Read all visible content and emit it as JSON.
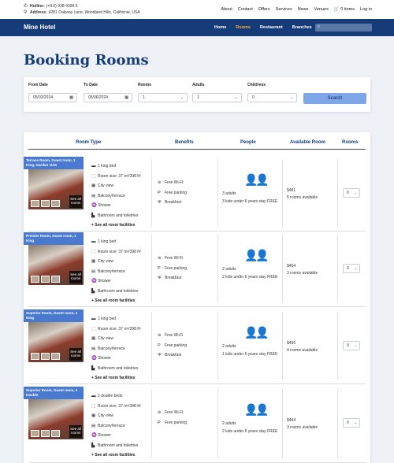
{
  "topbar": {
    "hotline_label": "Hotline:",
    "hotline_value": "(+8.0) 938-9399.5",
    "address_label": "Address:",
    "address_value": "4281 Oakway Lane, Woodland Hills, California, USA",
    "menu": [
      "About",
      "Contact",
      "Offers",
      "Services",
      "News",
      "Venues"
    ],
    "cart": "0 items",
    "login": "Log in"
  },
  "navbar": {
    "brand": "Mine Hotel",
    "links": [
      "Home",
      "Rooms",
      "Restaurant",
      "Branches"
    ],
    "active": "Rooms"
  },
  "page_title": "Booking Rooms",
  "form": {
    "from_label": "From Date",
    "from_value": "05/03/2024",
    "to_label": "To Date",
    "to_value": "05/06/2024",
    "rooms_label": "Rooms",
    "rooms_value": "1",
    "adults_label": "Adults",
    "adults_value": "1",
    "children_label": "Childrens",
    "children_value": "0",
    "search_label": "Search"
  },
  "table": {
    "headers": [
      "Room Type",
      "Benefits",
      "People",
      "Available Room",
      "Rooms"
    ],
    "see_all_photos": "See all rooms",
    "see_all_facilities": "+ See all room facilities",
    "rooms": [
      {
        "name": "Terrace Room, Guest room, 1 King, Garden view",
        "features": [
          "1 king bed",
          "Room size: 37 m²/398 ft²",
          "City view",
          "Balcony/terrace",
          "Shower",
          "Bathroom and toiletries"
        ],
        "benefits": [
          "Free Wi-Fi",
          "Free parking",
          "Breakfast"
        ],
        "adults": "3 adults",
        "kids": "3 kids under 6 years stay FREE",
        "price": "$481",
        "available": "5 rooms available",
        "qty": "0"
      },
      {
        "name": "Premier Room, Guest room, 1 King",
        "features": [
          "1 king bed",
          "Room size: 37 m²/398 ft²",
          "City view",
          "Balcony/terrace",
          "Shower",
          "Bathroom and toiletries"
        ],
        "benefits": [
          "Free Wi-Fi",
          "Free parking",
          "Breakfast"
        ],
        "adults": "2 adults",
        "kids": "2 kids under 6 years stay FREE",
        "price": "$454",
        "available": "3 rooms available",
        "qty": "0"
      },
      {
        "name": "Superior Room, Guest room, 1 King",
        "features": [
          "1 king bed",
          "Room size: 37 m²/398 ft²",
          "City view",
          "Balcony/terrace",
          "Shower",
          "Bathroom and toiletries"
        ],
        "benefits": [
          "Free Wi-Fi",
          "Free parking",
          "Breakfast"
        ],
        "adults": "2 adults",
        "kids": "1 kids under 6 years stay FREE",
        "price": "$496",
        "available": "4 rooms available",
        "qty": "0"
      },
      {
        "name": "Superior Room, Guest room, 2 Double",
        "features": [
          "2 double beds",
          "Room size: 37 m²/398 ft²",
          "City view",
          "Balcony/terrace",
          "Shower",
          "Bathroom and toiletries"
        ],
        "benefits": [
          "Free Wi-Fi",
          "Free parking"
        ],
        "adults": "2 adults",
        "kids": "2 kids under 6 years stay FREE",
        "price": "$444",
        "available": "3 rooms available",
        "qty": "0"
      }
    ]
  },
  "colors": {
    "navy": "#153c78",
    "accent": "#f3b23a",
    "button": "#7fa6e8",
    "label": "#4a7ad0"
  }
}
